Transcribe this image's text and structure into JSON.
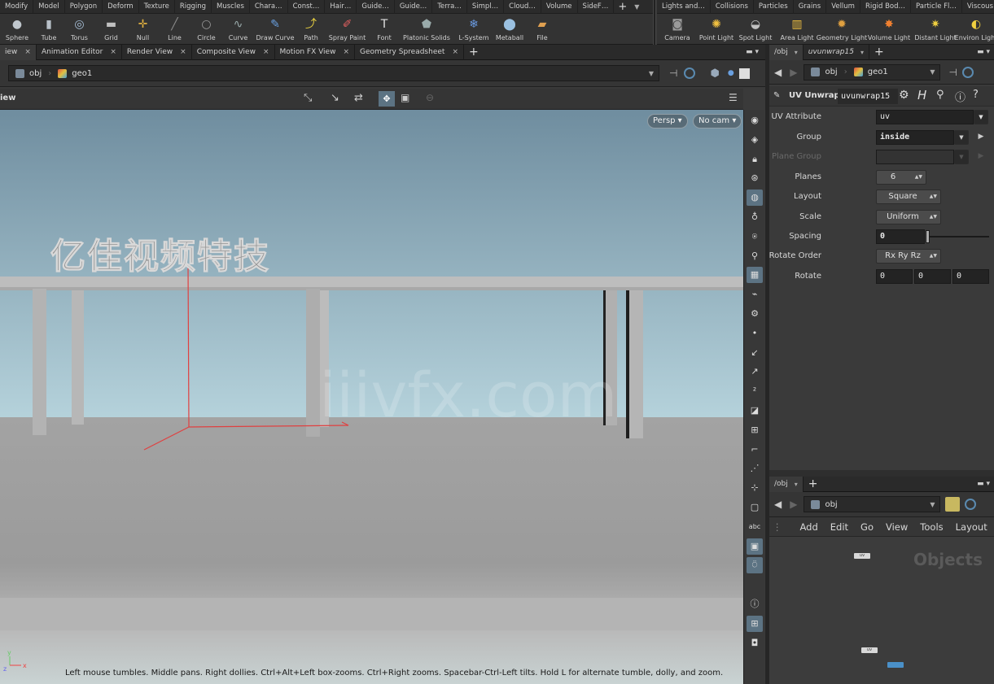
{
  "shelf_tabs_left": [
    "Modify",
    "Model",
    "Polygon",
    "Deform",
    "Texture",
    "Rigging",
    "Muscles",
    "Chara…",
    "Const…",
    "Hair…",
    "Guide…",
    "Guide…",
    "Terra…",
    "Simpl…",
    "Cloud…",
    "Volume",
    "SideF…"
  ],
  "shelf_tabs_right": [
    "Lights and…",
    "Collisions",
    "Particles",
    "Grains",
    "Vellum",
    "Rigid Bod…",
    "Particle Fl…",
    "Viscous Fl…"
  ],
  "tools_left": [
    {
      "label": "Sphere",
      "icon": "sphere-icon",
      "glyph": "●",
      "color": "#bfc6cc"
    },
    {
      "label": "Tube",
      "icon": "tube-icon",
      "glyph": "▮",
      "color": "#b8c0c8"
    },
    {
      "label": "Torus",
      "icon": "torus-icon",
      "glyph": "◎",
      "color": "#a8c0d8"
    },
    {
      "label": "Grid",
      "icon": "grid-icon",
      "glyph": "▬",
      "color": "#c0c0c0"
    },
    {
      "label": "Null",
      "icon": "null-icon",
      "glyph": "✛",
      "color": "#e0b040"
    },
    {
      "label": "Line",
      "icon": "line-icon",
      "glyph": "╱",
      "color": "#8a8a8a"
    },
    {
      "label": "Circle",
      "icon": "circle-icon",
      "glyph": "○",
      "color": "#9a9a9a"
    },
    {
      "label": "Curve",
      "icon": "curve-icon",
      "glyph": "∿",
      "color": "#9aa"
    },
    {
      "label": "Draw Curve",
      "icon": "draw-curve-icon",
      "glyph": "✎",
      "color": "#6aa0e0"
    },
    {
      "label": "Path",
      "icon": "path-icon",
      "glyph": "⤴",
      "color": "#e8d040"
    },
    {
      "label": "Spray Paint",
      "icon": "spray-paint-icon",
      "glyph": "✐",
      "color": "#e06060"
    },
    {
      "label": "Font",
      "icon": "font-icon",
      "glyph": "T",
      "color": "#e0e0e0"
    },
    {
      "label": "Platonic Solids",
      "icon": "platonic-solids-icon",
      "glyph": "⬟",
      "color": "#9aa"
    },
    {
      "label": "L-System",
      "icon": "l-system-icon",
      "glyph": "❄",
      "color": "#6a9ae0"
    },
    {
      "label": "Metaball",
      "icon": "metaball-icon",
      "glyph": "⬤",
      "color": "#9ac0e0"
    },
    {
      "label": "File",
      "icon": "file-icon",
      "glyph": "▰",
      "color": "#e0a050"
    }
  ],
  "tools_right": [
    {
      "label": "Camera",
      "icon": "camera-icon",
      "glyph": "◙",
      "color": "#9a9a9a"
    },
    {
      "label": "Point Light",
      "icon": "point-light-icon",
      "glyph": "✺",
      "color": "#f0c040"
    },
    {
      "label": "Spot Light",
      "icon": "spot-light-icon",
      "glyph": "◒",
      "color": "#c0c0c0"
    },
    {
      "label": "Area Light",
      "icon": "area-light-icon",
      "glyph": "▥",
      "color": "#f0c040"
    },
    {
      "label": "Geometry Light",
      "icon": "geometry-light-icon",
      "glyph": "✹",
      "color": "#e0a040"
    },
    {
      "label": "Volume Light",
      "icon": "volume-light-icon",
      "glyph": "✸",
      "color": "#f08030"
    },
    {
      "label": "Distant Light",
      "icon": "distant-light-icon",
      "glyph": "✷",
      "color": "#f0d040"
    },
    {
      "label": "Environ Light",
      "icon": "environment-light-icon",
      "glyph": "◐",
      "color": "#f0d040"
    }
  ],
  "viewer_tabs": [
    {
      "label": "iew",
      "close": "×",
      "active": true
    },
    {
      "label": "Animation Editor",
      "close": "×"
    },
    {
      "label": "Render View",
      "close": "×"
    },
    {
      "label": "Composite View",
      "close": "×"
    },
    {
      "label": "Motion FX View",
      "close": "×"
    },
    {
      "label": "Geometry Spreadsheet",
      "close": "×"
    }
  ],
  "viewer_path": {
    "root": "obj",
    "node": "geo1"
  },
  "viewer_title": "iew",
  "viewport": {
    "persp_label": "Persp ▾",
    "cam_label": "No cam ▾",
    "sign_text": "亿佳视频特技",
    "watermark": "iiivfx.com",
    "status": "Left mouse tumbles. Middle pans. Right dollies. Ctrl+Alt+Left box-zooms. Ctrl+Right zooms. Spacebar-Ctrl-Left tilts. Hold L for alternate tumble, dolly, and zoom.",
    "sky_top": "#6f8d9f",
    "sky_bottom": "#b6d3dc",
    "ground": "#9a9a9a",
    "axis_y": "y",
    "axis_x": "x",
    "axis_z": "z"
  },
  "param_pane": {
    "tabs": [
      {
        "label": "/obj"
      },
      {
        "label": "uvunwrap15"
      }
    ],
    "path": {
      "root": "obj",
      "node": "geo1"
    },
    "node_type": "UV Unwrap",
    "node_name": "uvunwrap15",
    "params": [
      {
        "label": "UV Attribute",
        "value": "uv",
        "kind": "field-menu"
      },
      {
        "label": "Group",
        "value": "inside",
        "kind": "field-menu-arrow"
      },
      {
        "label": "Plane Group",
        "value": "",
        "kind": "field-menu-arrow-dim"
      },
      {
        "label": "Planes",
        "value": "6",
        "kind": "stepper"
      },
      {
        "label": "Layout",
        "value": "Square",
        "kind": "menu"
      },
      {
        "label": "Scale",
        "value": "Uniform",
        "kind": "menu"
      },
      {
        "label": "Spacing",
        "value": "0",
        "kind": "slider"
      },
      {
        "label": "Rotate Order",
        "value": "Rx Ry Rz",
        "kind": "menu"
      },
      {
        "label": "Rotate",
        "values": [
          "0",
          "0",
          "0"
        ],
        "kind": "triple"
      }
    ]
  },
  "network_pane": {
    "tab": "/obj",
    "path": "obj",
    "menu": [
      "Add",
      "Edit",
      "Go",
      "View",
      "Tools",
      "Layout"
    ],
    "context_label": "Objects",
    "nodes": [
      {
        "label": "uv"
      },
      {
        "label": "uv"
      },
      {
        "label": ""
      }
    ]
  }
}
